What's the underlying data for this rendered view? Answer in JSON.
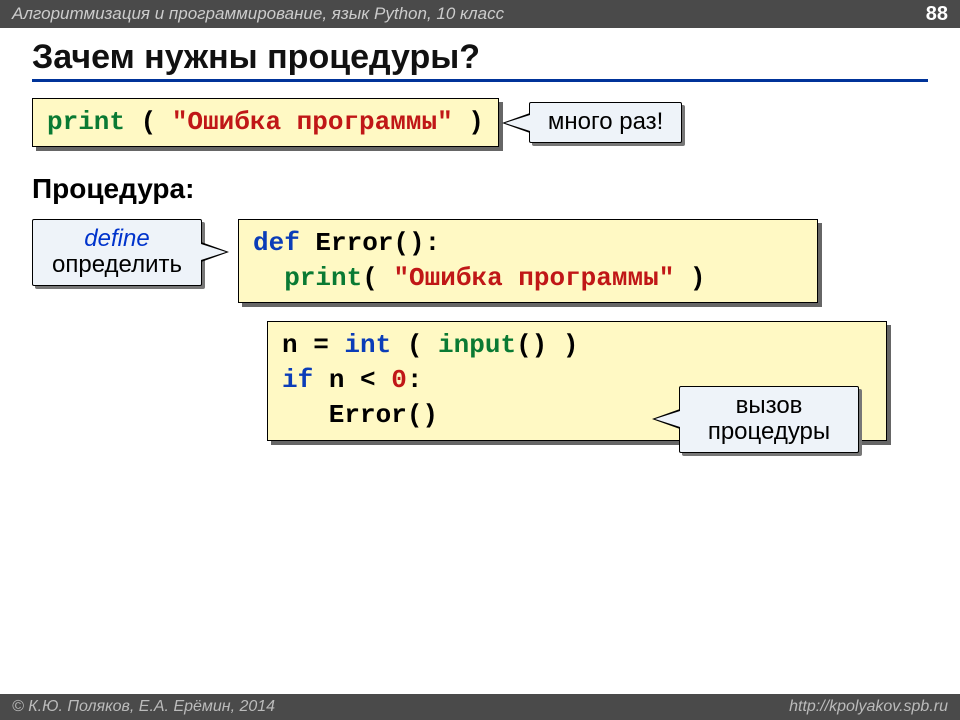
{
  "header": {
    "course": "Алгоритмизация и программирование, язык Python, 10 класс",
    "page": "88"
  },
  "title": "Зачем нужны процедуры?",
  "row1": {
    "code": {
      "print": "print",
      "open": " ( ",
      "str": "\"Ошибка программы\"",
      "close": " )"
    },
    "callout": "много раз!"
  },
  "section_label": "Процедура:",
  "define": {
    "line1": "define",
    "line2": "определить"
  },
  "defcode": {
    "def": "def",
    "name": " Error():",
    "indent": "  ",
    "print": "print",
    "open": "( ",
    "str": "\"Ошибка программы\"",
    "close": " )"
  },
  "maincode": {
    "l1a": "n",
    "l1b": " = ",
    "l1c": "int",
    "l1d": " ( ",
    "l1e": "input",
    "l1f": "() )",
    "l2a": "if",
    "l2b": " n < ",
    "l2c": "0",
    "l2d": ":",
    "l3": "   Error()"
  },
  "call_proc": {
    "line1": "вызов",
    "line2": "процедуры"
  },
  "footer": {
    "left": "© К.Ю. Поляков, Е.А. Ерёмин, 2014",
    "right": "http://kpolyakov.spb.ru"
  }
}
